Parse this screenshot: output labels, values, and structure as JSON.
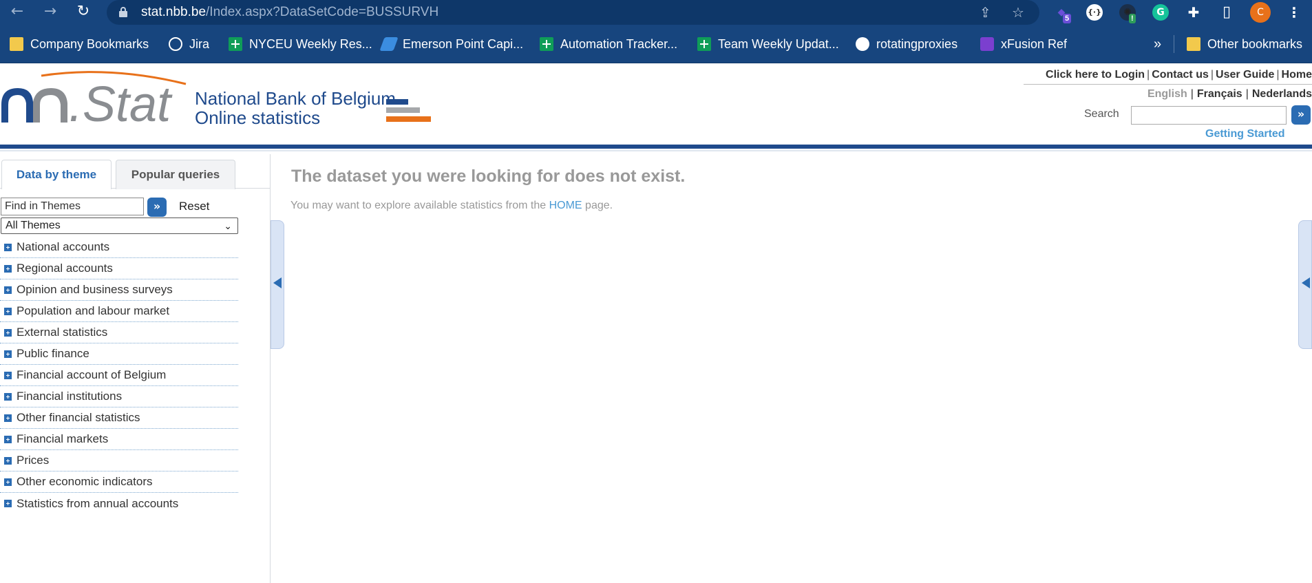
{
  "browser": {
    "back_icon": "←",
    "forward_icon": "→",
    "reload_icon": "↻",
    "url_host": "stat.nbb.be",
    "url_path": "/Index.aspx?DataSetCode=BUSSURVH",
    "share_icon": "⇪",
    "star_icon": "☆",
    "extensions": [
      {
        "name": "ext-one",
        "glyph": "◆",
        "badge": "5"
      },
      {
        "name": "ext-two",
        "glyph": "{·}",
        "badge": ""
      },
      {
        "name": "ext-three",
        "glyph": "✺",
        "badge": "!"
      },
      {
        "name": "grammarly",
        "glyph": "G",
        "badge": ""
      }
    ],
    "puzzle_icon": "✚",
    "sidepanel_icon": "▯",
    "profile_initial": "C",
    "menu_icon": "⋮",
    "accent_profile": "#e8711a"
  },
  "bookmarks": {
    "items": [
      {
        "label": "Company Bookmarks",
        "icon": "folder-icon"
      },
      {
        "label": "Jira",
        "icon": "globe-icon"
      },
      {
        "label": "NYCEU Weekly Res...",
        "icon": "sheets-icon"
      },
      {
        "label": "Emerson Point Capi...",
        "icon": "pin-icon"
      },
      {
        "label": "Automation Tracker...",
        "icon": "sheets-icon"
      },
      {
        "label": "Team Weekly Updat...",
        "icon": "sheets-icon"
      },
      {
        "label": "rotatingproxies",
        "icon": "github-icon"
      },
      {
        "label": "xFusion Ref",
        "icon": "list-icon"
      }
    ],
    "overflow": "»",
    "other": "Other bookmarks"
  },
  "site": {
    "logo_text": ".Stat",
    "logo_line1": "National Bank of Belgium",
    "logo_line2": "Online statistics",
    "top_links": [
      "Click here to Login",
      "Contact us",
      "User Guide",
      "Home"
    ],
    "languages": [
      "English",
      "Français",
      "Nederlands"
    ],
    "search_label": "Search",
    "search_go": "»",
    "getting_started": "Getting Started"
  },
  "left": {
    "tab_active": "Data by theme",
    "tab_inactive": "Popular queries",
    "find_placeholder": "Find in Themes",
    "find_go": "»",
    "reset": "Reset",
    "theme_select": "All Themes",
    "themes": [
      "National accounts",
      "Regional accounts",
      "Opinion and business surveys",
      "Population and labour market",
      "External statistics",
      "Public finance",
      "Financial account of Belgium",
      "Financial institutions",
      "Other financial statistics",
      "Financial markets",
      "Prices",
      "Other economic indicators",
      "Statistics from annual accounts"
    ]
  },
  "main": {
    "title": "The dataset you were looking for does not exist.",
    "body_before": "You may want to explore available statistics from the ",
    "body_link": "HOME",
    "body_after": " page."
  }
}
